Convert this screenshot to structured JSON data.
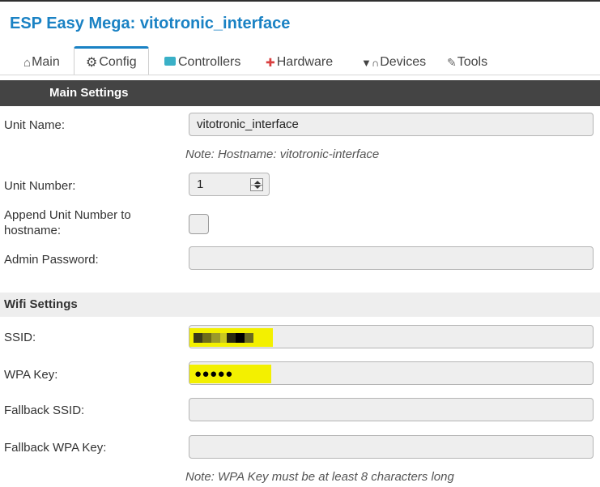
{
  "app": {
    "title": "ESP Easy Mega: vitotronic_interface"
  },
  "tabs": [
    {
      "label": "Main",
      "icon": "home-icon",
      "glyph": "⌂",
      "color": "#555555"
    },
    {
      "label": "Config",
      "icon": "gear-icon",
      "glyph": "⚙",
      "color": "#444444"
    },
    {
      "label": "Controllers",
      "icon": "chat-bubble-icon",
      "glyph": "💬",
      "color": "#3ab0c7"
    },
    {
      "label": "Hardware",
      "icon": "pin-icon",
      "glyph": "📌",
      "color": "#d94040"
    },
    {
      "label": "Devices",
      "icon": "plug-icon",
      "glyph": "🔌",
      "color": "#444444"
    },
    {
      "label": "Tools",
      "icon": "wrench-icon",
      "glyph": "🔧",
      "color": "#666666"
    }
  ],
  "main_settings": {
    "header": "Main Settings",
    "unit_name_label": "Unit Name:",
    "unit_name_value": "vitotronic_interface",
    "hostname_note": "Note: Hostname: vitotronic-interface",
    "unit_number_label": "Unit Number:",
    "unit_number_value": "1",
    "append_label": "Append Unit Number to hostname:",
    "admin_password_label": "Admin Password:",
    "admin_password_value": ""
  },
  "wifi_settings": {
    "header": "Wifi Settings",
    "ssid_label": "SSID:",
    "wpa_key_label": "WPA Key:",
    "wpa_key_masked": "●●●●●",
    "fallback_ssid_label": "Fallback SSID:",
    "fallback_ssid_value": "",
    "fallback_wpa_label": "Fallback WPA Key:",
    "fallback_wpa_value": "",
    "wpa_note": "Note: WPA Key must be at least 8 characters long"
  },
  "colors": {
    "accent": "#1a82c4",
    "section_dark": "#444444",
    "section_light": "#eeeeee",
    "redaction_highlight": "#f3f000"
  }
}
